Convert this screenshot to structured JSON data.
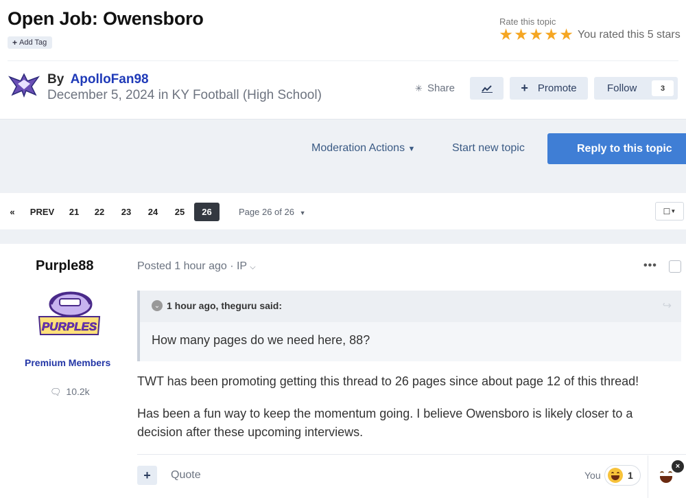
{
  "topic": {
    "title": "Open Job: Owensboro",
    "add_tag": "Add Tag",
    "rate_label": "Rate this topic",
    "rating": 5,
    "rating_max": 5,
    "rated_text": "You rated this 5 stars",
    "by_label": "By",
    "author": "ApolloFan98",
    "posted_in": "December 5, 2024 in KY Football (High School)"
  },
  "actions": {
    "share": "Share",
    "promote": "Promote",
    "follow": "Follow",
    "follow_count": "3",
    "moderation": "Moderation Actions",
    "start_topic": "Start new topic",
    "reply": "Reply to this topic"
  },
  "pagination": {
    "prev": "PREV",
    "pages": [
      "21",
      "22",
      "23",
      "24",
      "25",
      "26"
    ],
    "current": "26",
    "page_of": "Page 26 of 26"
  },
  "post": {
    "username": "Purple88",
    "avatar_text": "PURPLES",
    "group": "Premium Members",
    "post_count": "10.2k",
    "posted_meta": "Posted 1 hour ago · IP",
    "quote_citation": "1 hour ago, theguru said:",
    "quote_text": "How many pages do we need here, 88?",
    "paragraph1": "TWT has been promoting getting this thread to 26 pages since about page 12 of this thread!",
    "paragraph2": "Has been a fun way to keep the momentum going.  I believe Owensboro is likely closer to a decision after these upcoming interviews.",
    "quote_action": "Quote",
    "you_label": "You",
    "reaction_count": "1"
  },
  "colors": {
    "accent": "#3f7ed5",
    "author_link": "#1f3ab8",
    "star": "#f5a623",
    "band": "#eef1f5"
  }
}
